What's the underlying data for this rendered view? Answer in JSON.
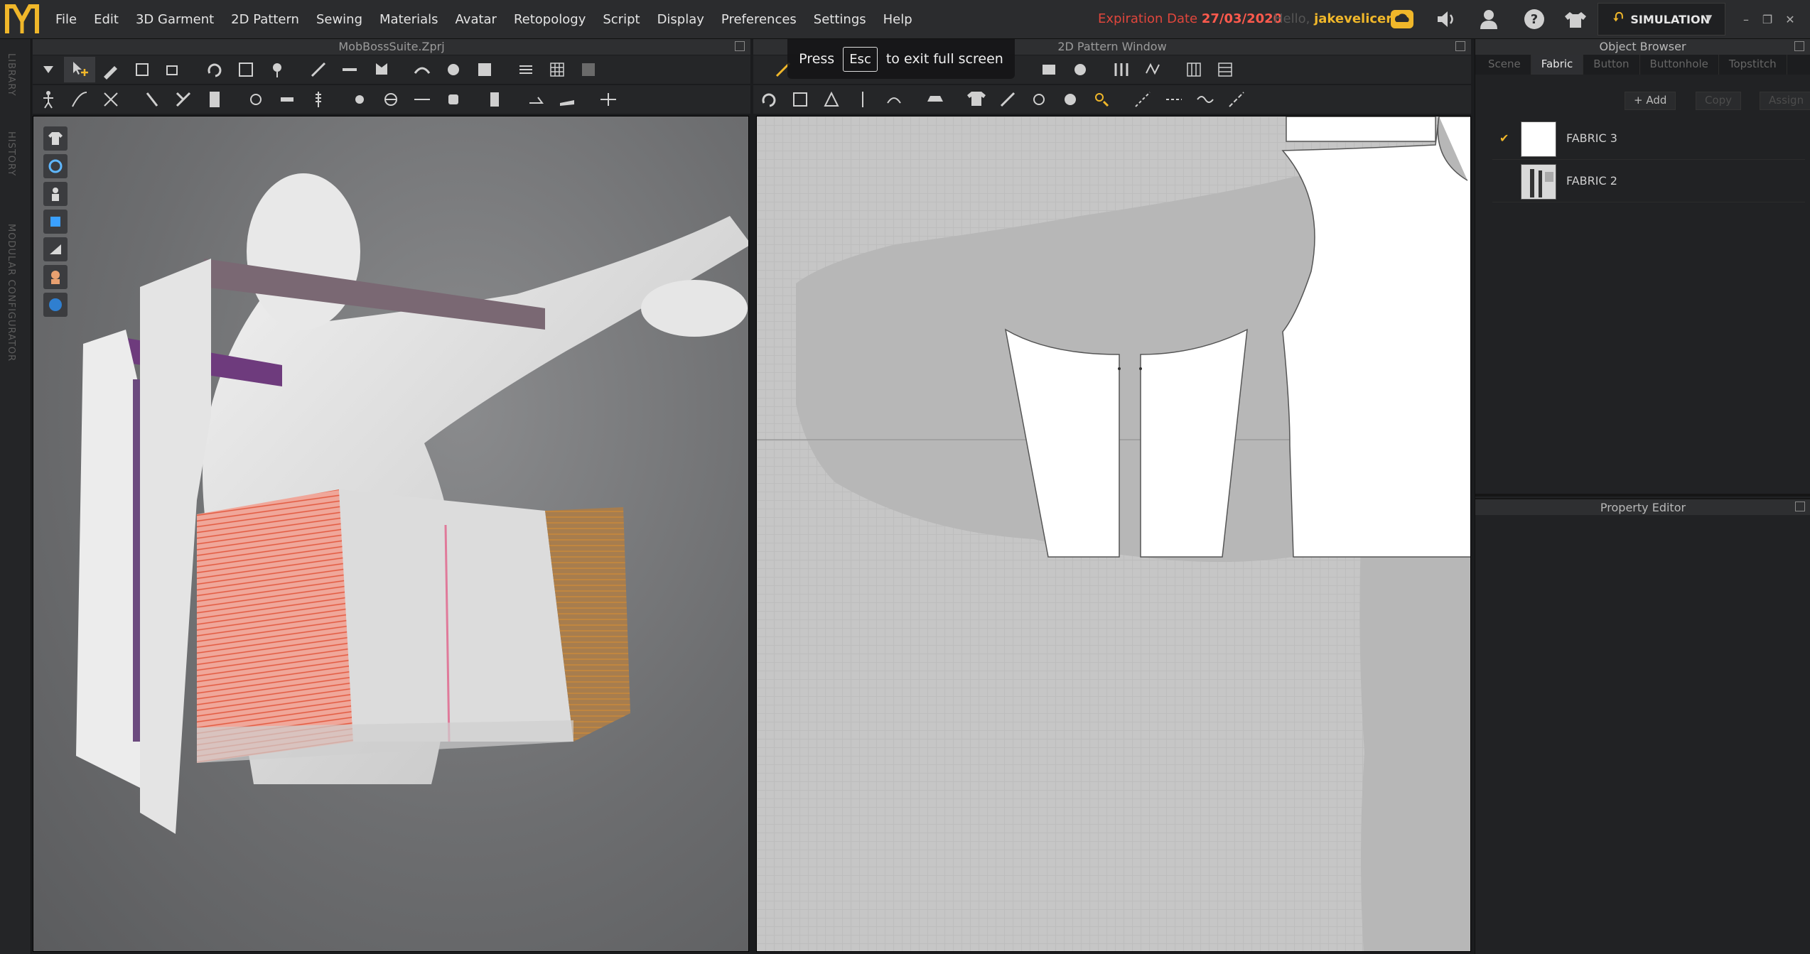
{
  "app": {
    "logo": "marvelous-designer-logo",
    "menu": [
      "File",
      "Edit",
      "3D Garment",
      "2D Pattern",
      "Sewing",
      "Materials",
      "Avatar",
      "Retopology",
      "Script",
      "Display",
      "Preferences",
      "Settings",
      "Help"
    ],
    "expiration_label": "Expiration Date",
    "expiration_value": "27/03/2020",
    "hello_label": "Hello,",
    "username": "jakevelicer",
    "mode_button": "SIMULATION"
  },
  "left_tabs": [
    "LIBRARY",
    "HISTORY",
    "MODULAR CONFIGURATOR"
  ],
  "panel_3d": {
    "title": "MobBossSuite.Zprj"
  },
  "panel_2d": {
    "title": "2D Pattern Window"
  },
  "overlay": {
    "press": "Press",
    "key": "Esc",
    "message": "to exit full screen"
  },
  "object_browser": {
    "title": "Object Browser",
    "tabs": [
      "Scene",
      "Fabric",
      "Button",
      "Buttonhole",
      "Topstitch"
    ],
    "active_tab": "Fabric",
    "actions": [
      "+ Add",
      "Copy",
      "Assign"
    ],
    "fabrics": [
      {
        "name": "FABRIC 3",
        "selected": true
      },
      {
        "name": "FABRIC 2",
        "selected": false
      }
    ]
  },
  "property_editor": {
    "title": "Property Editor"
  },
  "colors": {
    "accent": "#f0b72a",
    "expiry_red": "#e0463c"
  }
}
